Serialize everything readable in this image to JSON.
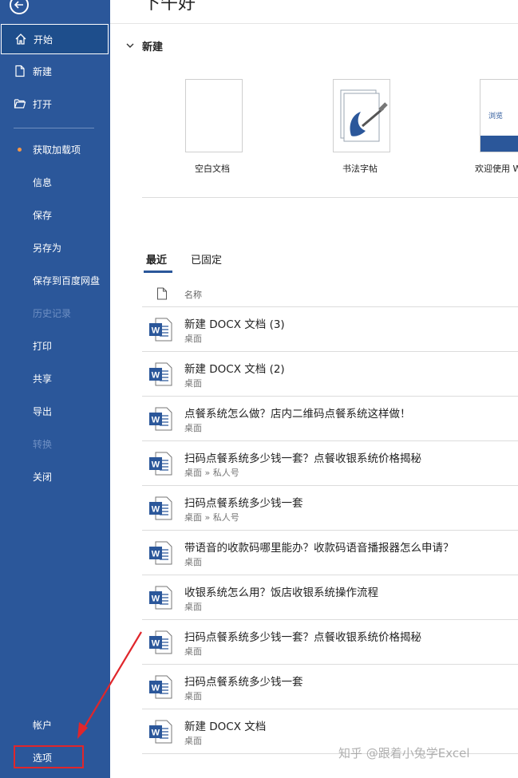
{
  "greeting": "下午好",
  "sidebar": {
    "items": [
      {
        "label": "开始",
        "icon": "home-icon",
        "active": true
      },
      {
        "label": "新建",
        "icon": "new-document-icon"
      },
      {
        "label": "打开",
        "icon": "folder-open-icon"
      },
      {
        "label": "获取加载项",
        "badge": "dot"
      },
      {
        "label": "信息"
      },
      {
        "label": "保存"
      },
      {
        "label": "另存为"
      },
      {
        "label": "保存到百度网盘"
      },
      {
        "label": "历史记录",
        "disabled": true
      },
      {
        "label": "打印"
      },
      {
        "label": "共享"
      },
      {
        "label": "导出"
      },
      {
        "label": "转换",
        "disabled": true
      },
      {
        "label": "关闭"
      }
    ],
    "account": "帐户",
    "options": "选项",
    "accent": "#2b579a",
    "highlight": "#e0262b"
  },
  "new_section": {
    "title": "新建",
    "templates": [
      {
        "label": "空白文档"
      },
      {
        "label": "书法字帖"
      },
      {
        "label": "欢迎使用 W",
        "thumb_text": "浏览"
      }
    ]
  },
  "tabs": [
    {
      "label": "最近",
      "active": true
    },
    {
      "label": "已固定"
    }
  ],
  "file_list": {
    "column_header": "名称",
    "files": [
      {
        "name": "新建 DOCX 文档 (3)",
        "path": "桌面"
      },
      {
        "name": "新建 DOCX 文档 (2)",
        "path": "桌面"
      },
      {
        "name": "点餐系统怎么做？店内二维码点餐系统这样做！",
        "path": "桌面"
      },
      {
        "name": "扫码点餐系统多少钱一套？点餐收银系统价格揭秘",
        "path": "桌面 » 私人号"
      },
      {
        "name": "扫码点餐系统多少钱一套",
        "path": "桌面 » 私人号"
      },
      {
        "name": "带语音的收款码哪里能办？收款码语音播报器怎么申请？",
        "path": "桌面"
      },
      {
        "name": "收银系统怎么用？饭店收银系统操作流程",
        "path": "桌面"
      },
      {
        "name": "扫码点餐系统多少钱一套？点餐收银系统价格揭秘",
        "path": "桌面"
      },
      {
        "name": "扫码点餐系统多少钱一套",
        "path": "桌面"
      },
      {
        "name": "新建 DOCX 文档",
        "path": "桌面"
      }
    ]
  },
  "watermark": "知乎 @跟着小兔学Excel"
}
